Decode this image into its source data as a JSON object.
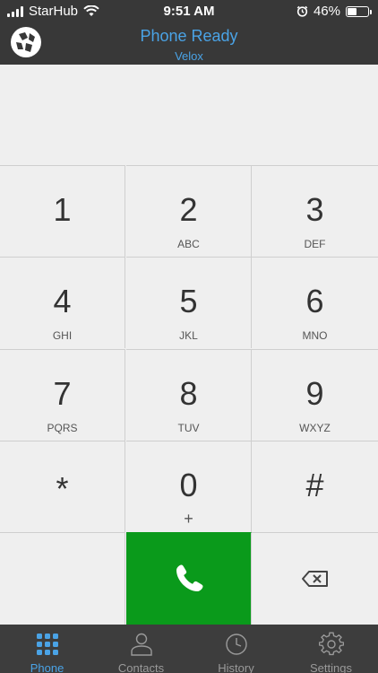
{
  "status_bar": {
    "carrier": "StarHub",
    "time": "9:51 AM",
    "battery_percent": "46%",
    "battery_level": 0.46,
    "icons": [
      "signal-icon",
      "wifi-icon",
      "alarm-icon",
      "battery-icon"
    ]
  },
  "header": {
    "title": "Phone Ready",
    "subtitle": "Velox",
    "title_color": "#4aa3e6"
  },
  "keypad": {
    "keys": [
      {
        "digit": "1",
        "letters": ""
      },
      {
        "digit": "2",
        "letters": "ABC"
      },
      {
        "digit": "3",
        "letters": "DEF"
      },
      {
        "digit": "4",
        "letters": "GHI"
      },
      {
        "digit": "5",
        "letters": "JKL"
      },
      {
        "digit": "6",
        "letters": "MNO"
      },
      {
        "digit": "7",
        "letters": "PQRS"
      },
      {
        "digit": "8",
        "letters": "TUV"
      },
      {
        "digit": "9",
        "letters": "WXYZ"
      },
      {
        "digit": "*",
        "letters": ""
      },
      {
        "digit": "0",
        "letters": "+"
      },
      {
        "digit": "#",
        "letters": ""
      }
    ],
    "call_button_color": "#0a9a1b",
    "call_icon": "phone-icon",
    "delete_icon": "backspace-icon"
  },
  "tabs": [
    {
      "label": "Phone",
      "icon": "keypad-icon",
      "active": true
    },
    {
      "label": "Contacts",
      "icon": "person-icon",
      "active": false
    },
    {
      "label": "History",
      "icon": "clock-icon",
      "active": false
    },
    {
      "label": "Settings",
      "icon": "gear-icon",
      "active": false
    }
  ],
  "colors": {
    "accent": "#4aa3e6",
    "call_green": "#0a9a1b",
    "bar_bg": "#383838"
  }
}
